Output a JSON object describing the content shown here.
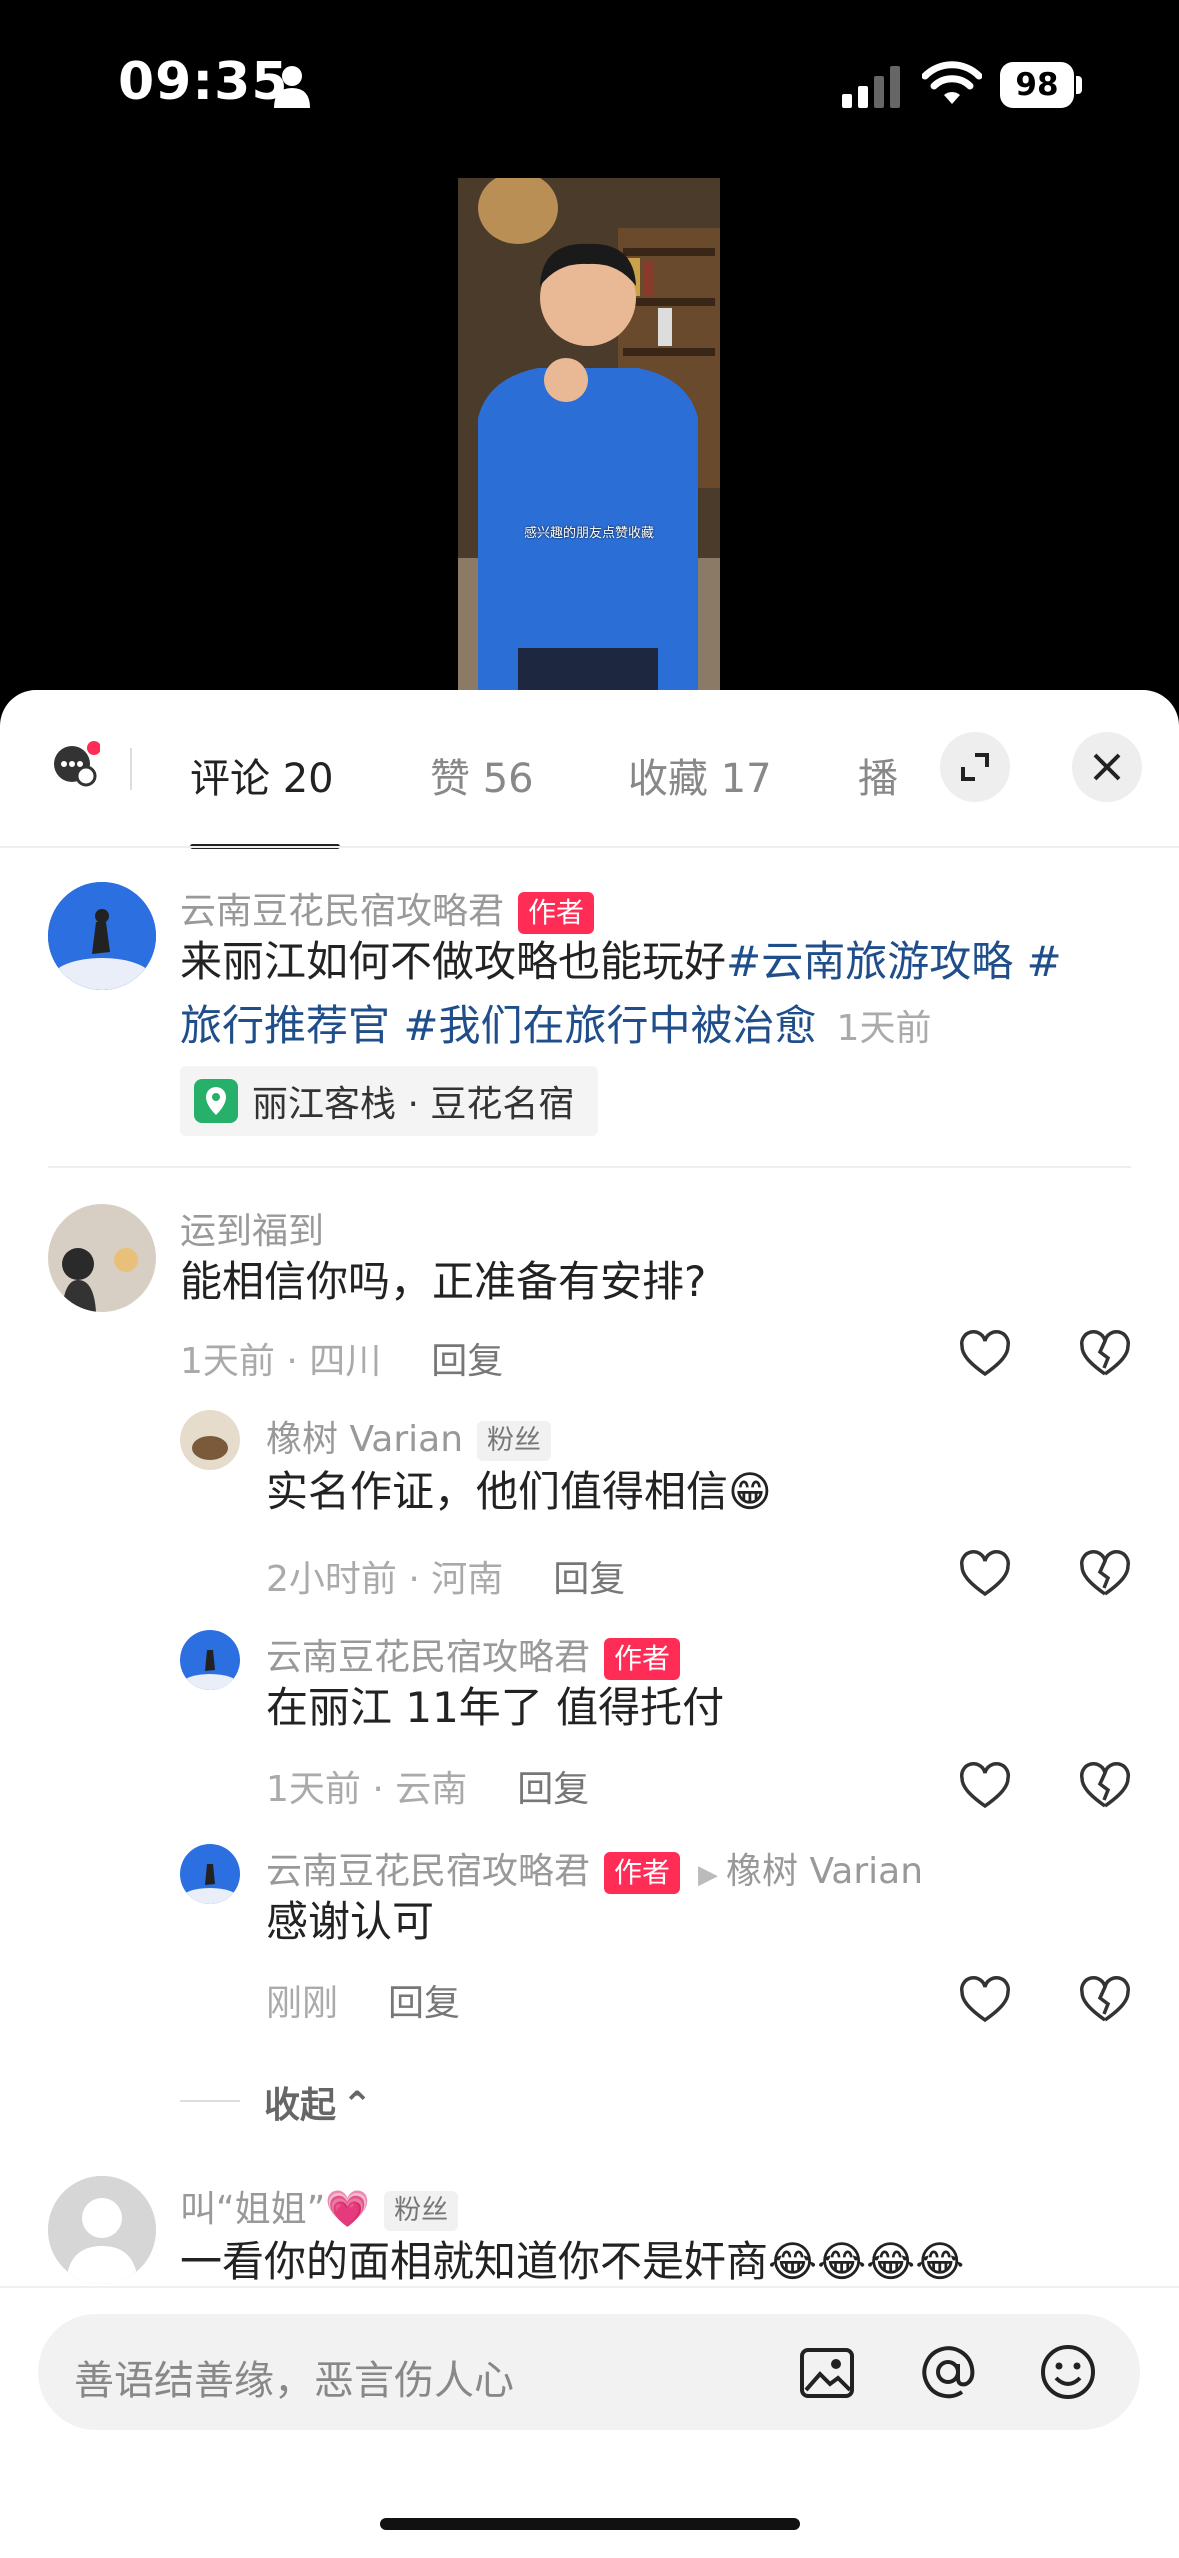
{
  "status_bar": {
    "time": "09:35",
    "battery": "98"
  },
  "video": {
    "subtitle": "感兴趣的朋友点赞收藏"
  },
  "tabs": [
    {
      "label": "评论 20"
    },
    {
      "label": "赞 56"
    },
    {
      "label": "收藏 17"
    },
    {
      "label": "播"
    }
  ],
  "post": {
    "author": "云南豆花民宿攻略君",
    "author_badge": "作者",
    "text_line1": "来丽江如何不做攻略也能玩好",
    "hashtag1": "#云南旅游攻略 #",
    "hashtag2": "旅行推荐官 #我们在旅行中被治愈",
    "time": "1天前",
    "location": "丽江客栈 · 豆花名宿"
  },
  "comments": [
    {
      "name": "运到福到",
      "text": "能相信你吗，正准备有安排?",
      "meta": "1天前 · 四川",
      "reply": "回复"
    }
  ],
  "replies": [
    {
      "name": "橡树 Varian",
      "badge": "粉丝",
      "text": "实名作证，他们值得相信",
      "emoji": "😁",
      "meta": "2小时前 · 河南",
      "reply": "回复"
    },
    {
      "name": "云南豆花民宿攻略君",
      "badge": "作者",
      "text": "在丽江 11年了 值得托付",
      "meta": "1天前 · 云南",
      "reply": "回复"
    },
    {
      "name": "云南豆花民宿攻略君",
      "badge": "作者",
      "reply_to": "橡树 Varian",
      "text": "感谢认可",
      "meta": "刚刚",
      "reply": "回复"
    }
  ],
  "collapse_label": "收起",
  "last_comment": {
    "name": "叫“姐姐”",
    "heart": "💗",
    "badge": "粉丝",
    "text": "一看你的面相就知道你不是奸商",
    "emojis": "😂😂😂😂"
  },
  "input": {
    "placeholder": "善语结善缘，恶言伤人心"
  }
}
